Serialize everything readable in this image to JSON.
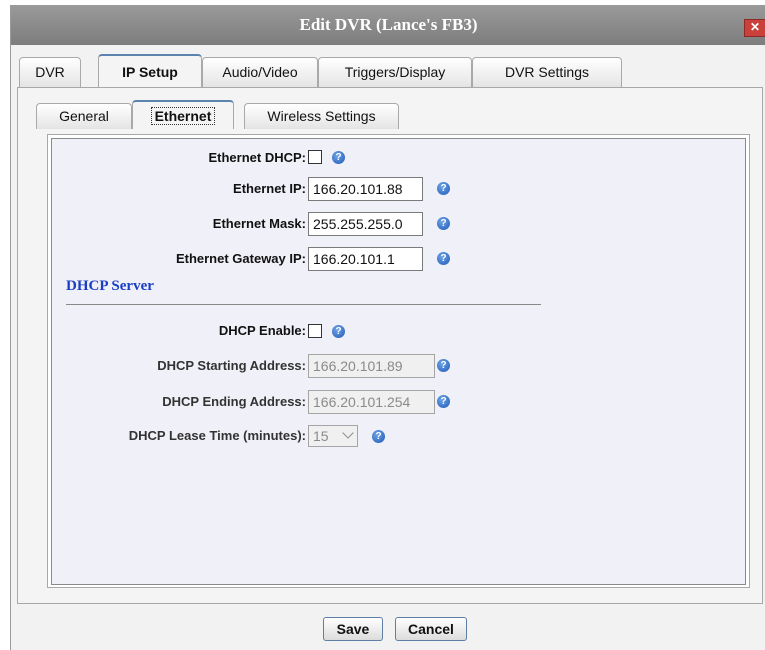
{
  "window": {
    "title": "Edit DVR (Lance's FB3)",
    "close_glyph": "✕"
  },
  "main_tabs": [
    {
      "label": "DVR"
    },
    {
      "label": "IP Setup"
    },
    {
      "label": "Audio/Video"
    },
    {
      "label": "Triggers/Display"
    },
    {
      "label": "DVR Settings"
    }
  ],
  "sub_tabs": [
    {
      "label": "General"
    },
    {
      "label": "Ethernet"
    },
    {
      "label": "Wireless Settings"
    }
  ],
  "form": {
    "ethernet_dhcp_label": "Ethernet DHCP:",
    "ethernet_dhcp_checked": false,
    "ethernet_ip_label": "Ethernet IP:",
    "ethernet_ip_value": "166.20.101.88",
    "ethernet_mask_label": "Ethernet Mask:",
    "ethernet_mask_value": "255.255.255.0",
    "ethernet_gateway_label": "Ethernet Gateway IP:",
    "ethernet_gateway_value": "166.20.101.1",
    "dhcp_server_title": "DHCP Server",
    "dhcp_enable_label": "DHCP Enable:",
    "dhcp_enable_checked": false,
    "dhcp_start_label": "DHCP Starting Address:",
    "dhcp_start_value": "166.20.101.89",
    "dhcp_end_label": "DHCP Ending Address:",
    "dhcp_end_value": "166.20.101.254",
    "dhcp_lease_label": "DHCP Lease Time (minutes):",
    "dhcp_lease_value": "15",
    "help_glyph": "?"
  },
  "buttons": {
    "save": "Save",
    "cancel": "Cancel"
  },
  "colors": {
    "section_title": "#1a3fc4",
    "help_icon": "#1f58b6",
    "close_button": "#c9413a"
  },
  "icons": {
    "help": "help-question-icon",
    "close": "close-icon",
    "dropdown": "chevron-down-icon"
  }
}
